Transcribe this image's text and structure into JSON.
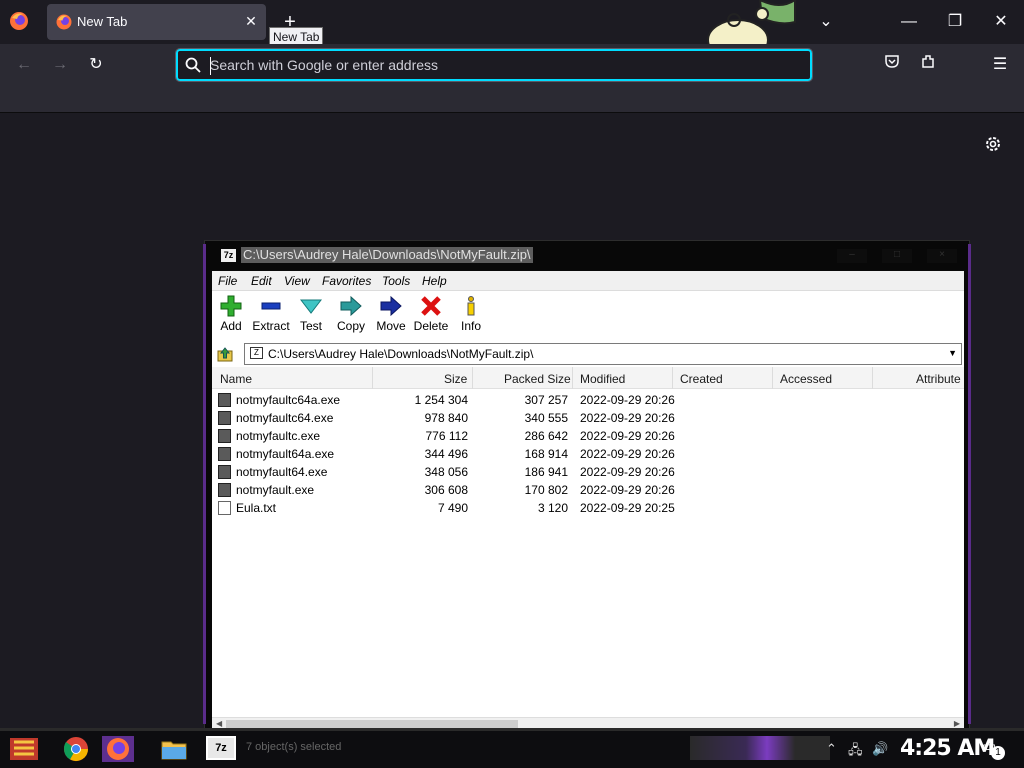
{
  "browser": {
    "tab": {
      "title": "New Tab"
    },
    "tooltip": "New Tab",
    "urlbar": {
      "placeholder": "Search with Google or enter address"
    }
  },
  "sevenzip": {
    "title_path": "C:\\Users\\Audrey Hale\\Downloads\\NotMyFault.zip\\",
    "menu": [
      "File",
      "Edit",
      "View",
      "Favorites",
      "Tools",
      "Help"
    ],
    "tools": [
      "Add",
      "Extract",
      "Test",
      "Copy",
      "Move",
      "Delete",
      "Info"
    ],
    "address": "C:\\Users\\Audrey Hale\\Downloads\\NotMyFault.zip\\",
    "columns": [
      "Name",
      "Size",
      "Packed Size",
      "Modified",
      "Created",
      "Accessed",
      "Attribute"
    ],
    "files": [
      {
        "name": "notmyfaultc64a.exe",
        "size": "1 254 304",
        "packed": "307 257",
        "modified": "2022-09-29 20:26",
        "type": "exe"
      },
      {
        "name": "notmyfaultc64.exe",
        "size": "978 840",
        "packed": "340 555",
        "modified": "2022-09-29 20:26",
        "type": "exe"
      },
      {
        "name": "notmyfaultc.exe",
        "size": "776 112",
        "packed": "286 642",
        "modified": "2022-09-29 20:26",
        "type": "exe"
      },
      {
        "name": "notmyfault64a.exe",
        "size": "344 496",
        "packed": "168 914",
        "modified": "2022-09-29 20:26",
        "type": "exe"
      },
      {
        "name": "notmyfault64.exe",
        "size": "348 056",
        "packed": "186 941",
        "modified": "2022-09-29 20:26",
        "type": "exe"
      },
      {
        "name": "notmyfault.exe",
        "size": "306 608",
        "packed": "170 802",
        "modified": "2022-09-29 20:26",
        "type": "exe"
      },
      {
        "name": "Eula.txt",
        "size": "7 490",
        "packed": "3 120",
        "modified": "2022-09-29 20:25",
        "type": "txt"
      }
    ]
  },
  "taskbar": {
    "app_7z_label": "7z",
    "status": "7 object(s) selected",
    "clock": "4:25 AM",
    "notification_count": "1"
  }
}
